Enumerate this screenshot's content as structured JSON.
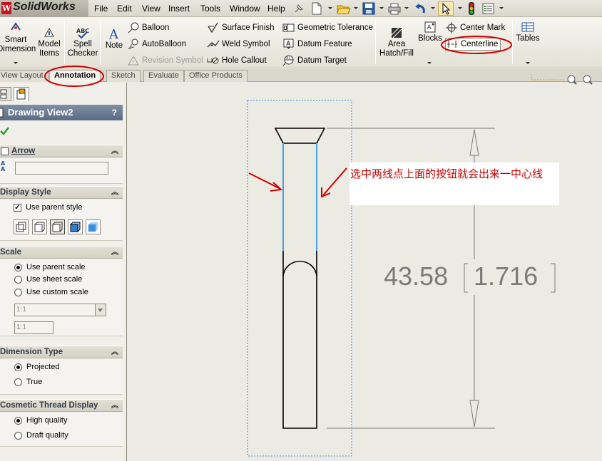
{
  "app": {
    "name": "SolidWorks",
    "logo_glyph": "ds"
  },
  "menu": [
    "File",
    "Edit",
    "View",
    "Insert",
    "Tools",
    "Window",
    "Help"
  ],
  "ribbon": {
    "smart_dimension": [
      "Smart",
      "Dimension"
    ],
    "model_items": [
      "Model",
      "Items"
    ],
    "spell_checker": [
      "Spell",
      "Checker"
    ],
    "note": "Note",
    "balloon": "Balloon",
    "autoballoon": "AutoBalloon",
    "revision_symbol": "Revision Symbol",
    "surface_finish": "Surface Finish",
    "weld_symbol": "Weld Symbol",
    "hole_callout": "Hole Callout",
    "geometric_tolerance": "Geometric Tolerance",
    "datum_feature": "Datum Feature",
    "datum_target": "Datum Target",
    "area_hatch": [
      "Area",
      "Hatch/Fill"
    ],
    "blocks": "Blocks",
    "center_mark": "Center Mark",
    "centerline": "Centerline",
    "tables": "Tables"
  },
  "tabs": [
    "View Layout",
    "Annotation",
    "Sketch",
    "Evaluate",
    "Office Products"
  ],
  "panel": {
    "title": "Drawing View2",
    "help": "?",
    "arrow": {
      "label": "Arrow",
      "checked": false,
      "field_prefix": "A"
    },
    "display_style": {
      "label": "Display Style",
      "use_parent": "Use parent style",
      "checked": true
    },
    "scale": {
      "label": "Scale",
      "options": [
        "Use parent scale",
        "Use sheet scale",
        "Use custom scale"
      ],
      "selected": 0,
      "dropdown_value": "1:1",
      "field_value": "1:1"
    },
    "dimension_type": {
      "label": "Dimension Type",
      "options": [
        "Projected",
        "True"
      ],
      "selected": 0
    },
    "thread_display": {
      "label": "Cosmetic Thread Display",
      "options": [
        "High quality",
        "Draft quality"
      ],
      "selected": 0
    }
  },
  "drawing": {
    "annotation": "选中两线点上面的按钮就会出来一中心线",
    "dimension_value": "43.58",
    "dimension_alt": "1.716"
  },
  "colors": {
    "highlight_ellipse": "#d00000",
    "annotation_text": "#c00000",
    "selected_line": "#4a9fe0",
    "dimension_text": "#7a7a7a",
    "panel_title_bg": "#5b6b83"
  }
}
